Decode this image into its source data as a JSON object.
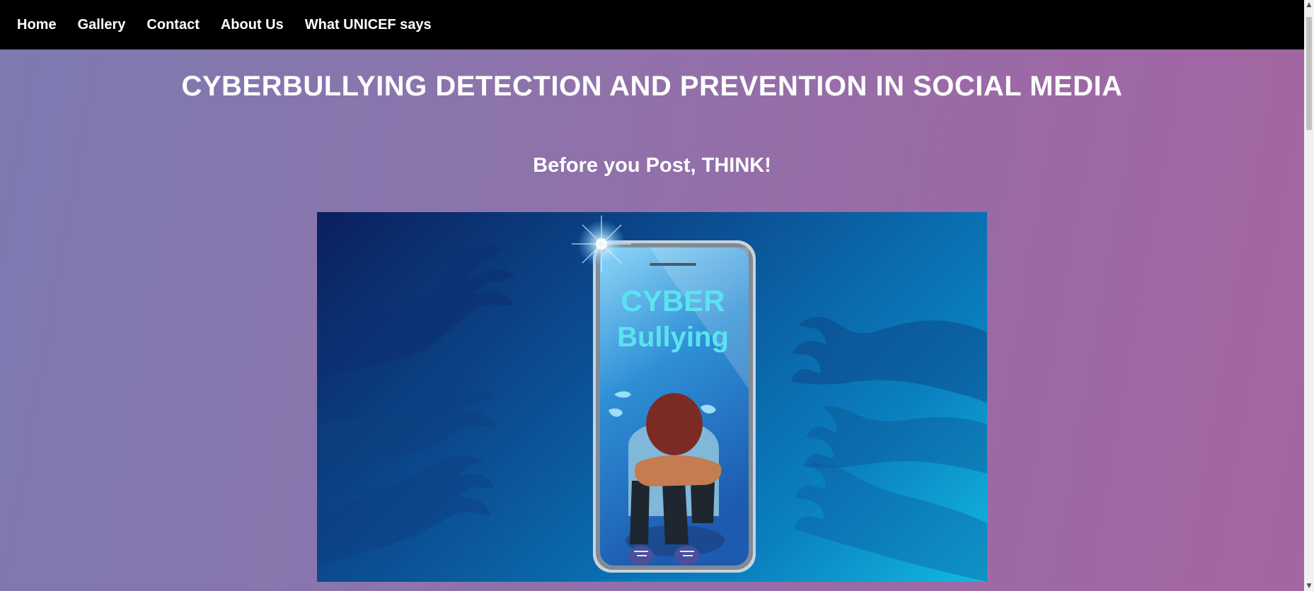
{
  "nav": {
    "items": [
      "Home",
      "Gallery",
      "Contact",
      "About Us",
      "What UNICEF says"
    ]
  },
  "header": {
    "title": "CYBERBULLYING DETECTION AND PREVENTION IN SOCIAL MEDIA",
    "subtitle": "Before you Post, THINK!"
  },
  "hero": {
    "line1": "CYBER",
    "line2": "Bullying"
  },
  "colors": {
    "navbar": "#000000",
    "text": "#ffffff",
    "phone_text": "#5be3f0"
  }
}
